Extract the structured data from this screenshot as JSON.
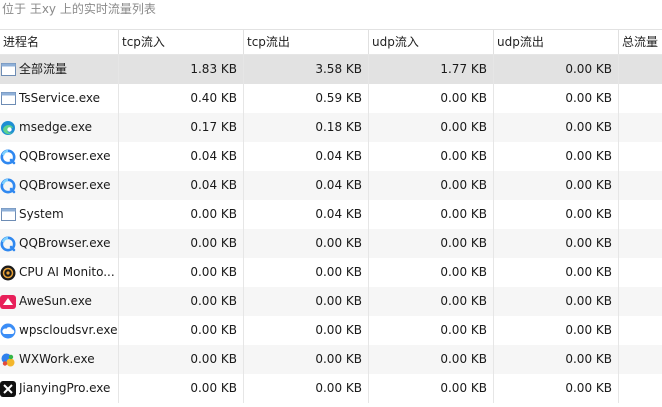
{
  "subtitle": "位于 王xy 上的实时流量列表",
  "columns": [
    "进程名",
    "tcp流入",
    "tcp流出",
    "udp流入",
    "udp流出",
    "总流量"
  ],
  "rows": [
    {
      "name": "全部流量",
      "icon": "window-icon",
      "tcp_in": "1.83 KB",
      "tcp_out": "3.58 KB",
      "udp_in": "1.77 KB",
      "udp_out": "0.00 KB"
    },
    {
      "name": "TsService.exe",
      "icon": "window-icon",
      "tcp_in": "0.40 KB",
      "tcp_out": "0.59 KB",
      "udp_in": "0.00 KB",
      "udp_out": "0.00 KB"
    },
    {
      "name": "msedge.exe",
      "icon": "edge-icon",
      "tcp_in": "0.17 KB",
      "tcp_out": "0.18 KB",
      "udp_in": "0.00 KB",
      "udp_out": "0.00 KB"
    },
    {
      "name": "QQBrowser.exe",
      "icon": "qqbrowser-icon",
      "tcp_in": "0.04 KB",
      "tcp_out": "0.04 KB",
      "udp_in": "0.00 KB",
      "udp_out": "0.00 KB"
    },
    {
      "name": "QQBrowser.exe",
      "icon": "qqbrowser-icon",
      "tcp_in": "0.04 KB",
      "tcp_out": "0.04 KB",
      "udp_in": "0.00 KB",
      "udp_out": "0.00 KB"
    },
    {
      "name": "System",
      "icon": "window-icon",
      "tcp_in": "0.00 KB",
      "tcp_out": "0.04 KB",
      "udp_in": "0.00 KB",
      "udp_out": "0.00 KB"
    },
    {
      "name": "QQBrowser.exe",
      "icon": "qqbrowser-icon",
      "tcp_in": "0.00 KB",
      "tcp_out": "0.00 KB",
      "udp_in": "0.00 KB",
      "udp_out": "0.00 KB"
    },
    {
      "name": "CPU AI Monito...",
      "icon": "cpu-monitor-icon",
      "tcp_in": "0.00 KB",
      "tcp_out": "0.00 KB",
      "udp_in": "0.00 KB",
      "udp_out": "0.00 KB"
    },
    {
      "name": "AweSun.exe",
      "icon": "awesun-icon",
      "tcp_in": "0.00 KB",
      "tcp_out": "0.00 KB",
      "udp_in": "0.00 KB",
      "udp_out": "0.00 KB"
    },
    {
      "name": "wpscloudsvr.exe",
      "icon": "cloud-icon",
      "tcp_in": "0.00 KB",
      "tcp_out": "0.00 KB",
      "udp_in": "0.00 KB",
      "udp_out": "0.00 KB"
    },
    {
      "name": "WXWork.exe",
      "icon": "wxwork-icon",
      "tcp_in": "0.00 KB",
      "tcp_out": "0.00 KB",
      "udp_in": "0.00 KB",
      "udp_out": "0.00 KB"
    },
    {
      "name": "JianyingPro.exe",
      "icon": "jianying-icon",
      "tcp_in": "0.00 KB",
      "tcp_out": "0.00 KB",
      "udp_in": "0.00 KB",
      "udp_out": "0.00 KB"
    }
  ]
}
